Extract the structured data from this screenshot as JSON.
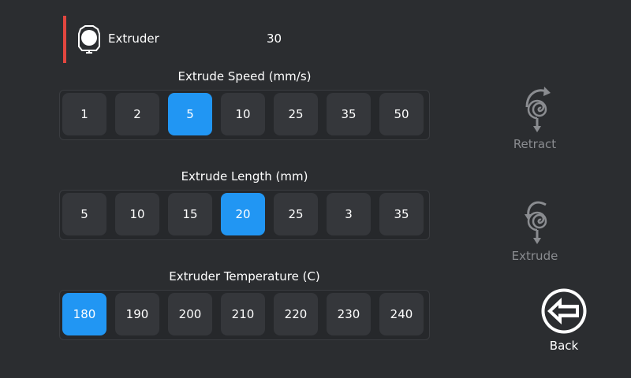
{
  "header": {
    "title": "Extruder",
    "temperature": "30",
    "icon": "extruder-icon",
    "accent_color": "#e2463f"
  },
  "groups": [
    {
      "label": "Extrude Speed (mm/s)",
      "options": [
        "1",
        "2",
        "5",
        "10",
        "25",
        "35",
        "50"
      ],
      "selected": "5"
    },
    {
      "label": "Extrude Length (mm)",
      "options": [
        "5",
        "10",
        "15",
        "20",
        "25",
        "3",
        "35"
      ],
      "selected": "20"
    },
    {
      "label": "Extruder Temperature (C)",
      "options": [
        "180",
        "190",
        "200",
        "210",
        "220",
        "230",
        "240"
      ],
      "selected": "180"
    }
  ],
  "actions": {
    "retract_label": "Retract",
    "extrude_label": "Extrude",
    "back_label": "Back"
  },
  "colors": {
    "background": "#2b2d30",
    "button": "#35373b",
    "selected": "#2196f3",
    "disabled_text": "#8a8c90"
  }
}
